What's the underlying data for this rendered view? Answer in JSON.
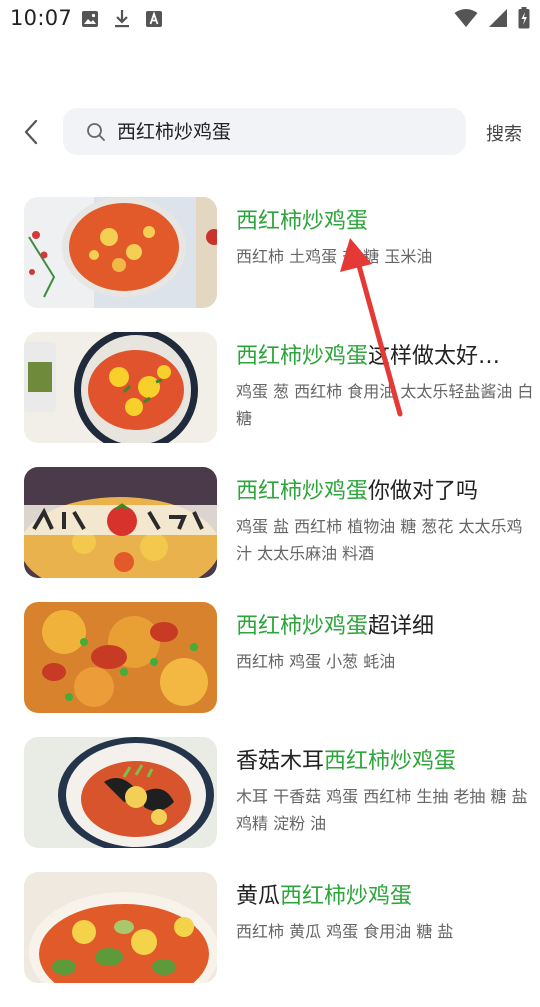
{
  "status_bar": {
    "time": "10:07"
  },
  "search": {
    "query": "西红柿炒鸡蛋",
    "button_label": "搜索"
  },
  "results": [
    {
      "title_highlight": "西红柿炒鸡蛋",
      "title_pre": "",
      "title_post": "",
      "ingredients": "西红柿 土鸡蛋 盐 糖 玉米油"
    },
    {
      "title_highlight": "西红柿炒鸡蛋",
      "title_pre": "",
      "title_post": "这样做太好…",
      "ingredients": "鸡蛋 葱 西红柿 食用油 太太乐轻盐酱油 白糖"
    },
    {
      "title_highlight": "西红柿炒鸡蛋",
      "title_pre": "",
      "title_post": "你做对了吗",
      "ingredients": "鸡蛋 盐 西红柿 植物油 糖 葱花 太太乐鸡汁 太太乐麻油 料酒"
    },
    {
      "title_highlight": "西红柿炒鸡蛋",
      "title_pre": "",
      "title_post": "超详细",
      "ingredients": "西红柿 鸡蛋 小葱 蚝油"
    },
    {
      "title_highlight": "西红柿炒鸡蛋",
      "title_pre": "香菇木耳",
      "title_post": "",
      "ingredients": "木耳 干香菇 鸡蛋 西红柿 生抽 老抽 糖 盐 鸡精 淀粉 油"
    },
    {
      "title_highlight": "西红柿炒鸡蛋",
      "title_pre": "黄瓜",
      "title_post": "",
      "ingredients": "西红柿 黄瓜 鸡蛋 食用油 糖 盐"
    }
  ],
  "colors": {
    "highlight": "#2ca53a",
    "annotation": "#e53935",
    "search_bg": "#f1f3f6"
  }
}
